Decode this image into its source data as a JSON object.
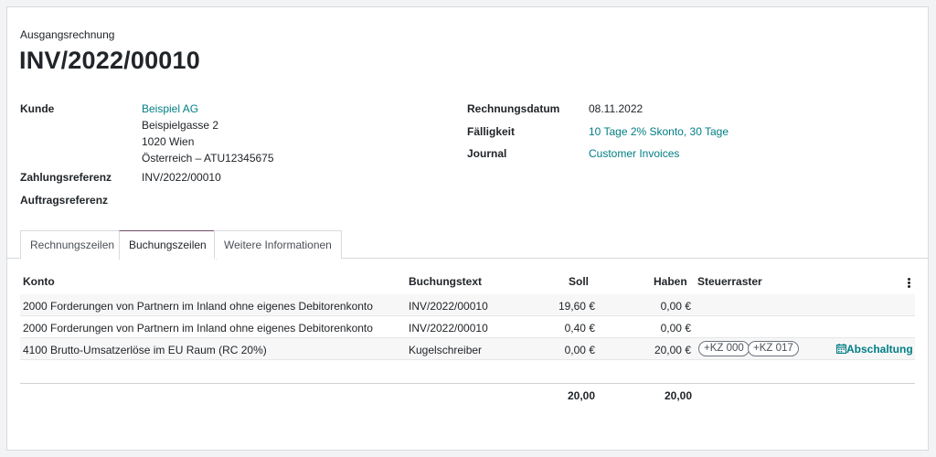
{
  "header": {
    "doc_type": "Ausgangsrechnung",
    "title": "INV/2022/00010"
  },
  "fields": {
    "kunde_label": "Kunde",
    "kunde_name": "Beispiel AG",
    "kunde_street": "Beispielgasse 2",
    "kunde_city": "1020 Wien",
    "kunde_country": "Österreich – ATU12345675",
    "zahlungsreferenz_label": "Zahlungsreferenz",
    "zahlungsreferenz_value": "INV/2022/00010",
    "auftragsreferenz_label": "Auftragsreferenz",
    "rechnungsdatum_label": "Rechnungsdatum",
    "rechnungsdatum_value": "08.11.2022",
    "faelligkeit_label": "Fälligkeit",
    "faelligkeit_value": "10 Tage 2% Skonto, 30 Tage",
    "journal_label": "Journal",
    "journal_value": "Customer Invoices"
  },
  "tabs": [
    {
      "label": "Rechnungszeilen"
    },
    {
      "label": "Buchungszeilen"
    },
    {
      "label": "Weitere Informationen"
    }
  ],
  "table": {
    "headers": {
      "konto": "Konto",
      "buchungstext": "Buchungstext",
      "soll": "Soll",
      "haben": "Haben",
      "steuerraster": "Steuerraster"
    },
    "rows": [
      {
        "konto": "2000 Forderungen von Partnern im Inland ohne eigenes Debitorenkonto",
        "buchungstext": "INV/2022/00010",
        "soll": "19,60 €",
        "haben": "0,00 €"
      },
      {
        "konto": "2000 Forderungen von Partnern im Inland ohne eigenes Debitorenkonto",
        "buchungstext": "INV/2022/00010",
        "soll": "0,40 €",
        "haben": "0,00 €"
      },
      {
        "konto": "4100 Brutto-Umsatzerlöse im EU Raum (RC 20%)",
        "buchungstext": "Kugelschreiber",
        "soll": "0,00 €",
        "haben": "20,00 €",
        "tags": [
          "+KZ 000",
          "+KZ 017"
        ],
        "action": "Abschaltung"
      }
    ],
    "totals": {
      "soll": "20,00",
      "haben": "20,00"
    }
  },
  "colors": {
    "accent": "#017e84",
    "active_tab": "#714b67"
  }
}
